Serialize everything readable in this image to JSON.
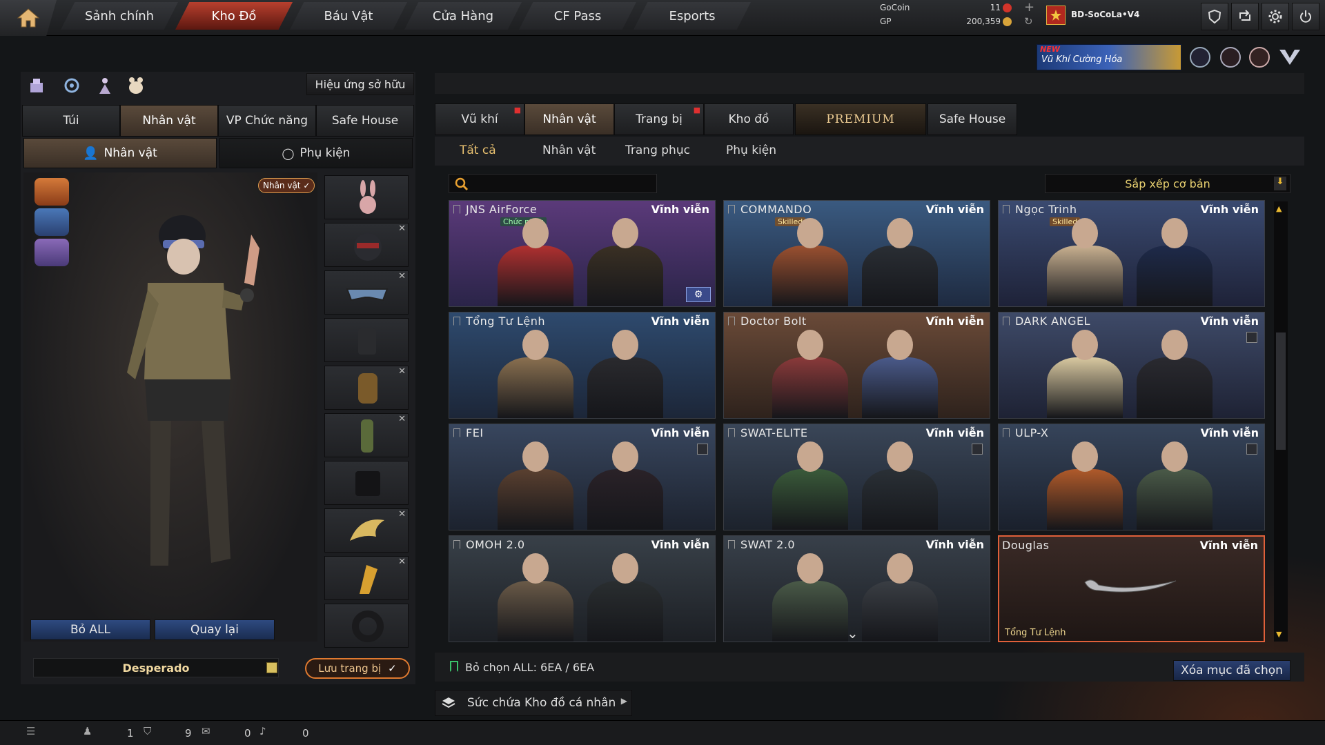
{
  "nav": {
    "tabs": [
      "Sảnh chính",
      "Kho Đồ",
      "Báu Vật",
      "Cửa Hàng",
      "CF Pass",
      "Esports"
    ],
    "active_index": 1
  },
  "currency": {
    "gocoin_label": "GoCoin",
    "gocoin_value": "11",
    "gp_label": "GP",
    "gp_value": "200,359"
  },
  "player": {
    "name": "BD-SoCoLa•V4"
  },
  "promo": {
    "new_label": "NEW",
    "text": "Vũ Khí Cường Hóa"
  },
  "left": {
    "effect_button": "Hiệu ứng sở hữu",
    "tabs": [
      "Túi",
      "Nhân vật",
      "VP Chức năng",
      "Safe House"
    ],
    "active_tab": 1,
    "subtabs": [
      "Nhân vật",
      "Phụ kiện"
    ],
    "character_badge": "Nhân vật ✓",
    "remove_all": "Bỏ ALL",
    "back": "Quay lại",
    "preset_name": "Desperado",
    "save_button": "Lưu trang bị"
  },
  "right": {
    "tabs": [
      "Vũ khí",
      "Nhân vật",
      "Trang bị",
      "Kho đồ",
      "PREMIUM",
      "Safe House"
    ],
    "active_tab": 1,
    "filters": [
      "Tất cả",
      "Nhân vật",
      "Trang phục",
      "Phụ kiện"
    ],
    "active_filter": 0,
    "search_placeholder": "",
    "sort_label": "Sắp xếp cơ bản",
    "items": [
      {
        "name": "JNS AirForce",
        "duration": "Vĩnh viễn",
        "tag": "Chức năng",
        "tag_type": "func",
        "gear": true
      },
      {
        "name": "COMMANDO",
        "duration": "Vĩnh viễn",
        "tag": "Skilled",
        "tag_type": "skilled"
      },
      {
        "name": "Ngọc Trinh",
        "duration": "Vĩnh viễn",
        "tag": "Skilled",
        "tag_type": "skilled"
      },
      {
        "name": "Tổng Tư Lệnh",
        "duration": "Vĩnh viễn"
      },
      {
        "name": "Doctor Bolt",
        "duration": "Vĩnh viễn"
      },
      {
        "name": "DARK ANGEL",
        "duration": "Vĩnh viễn",
        "lock": true
      },
      {
        "name": "FEI",
        "duration": "Vĩnh viễn",
        "lock": true
      },
      {
        "name": "SWAT-ELITE",
        "duration": "Vĩnh viễn",
        "lock": true
      },
      {
        "name": "ULP-X",
        "duration": "Vĩnh viễn",
        "lock": true
      },
      {
        "name": "OMOH 2.0",
        "duration": "Vĩnh viễn"
      },
      {
        "name": "SWAT 2.0",
        "duration": "Vĩnh viễn"
      },
      {
        "name": "Douglas",
        "duration": "Vĩnh viễn",
        "sub": "Tổng Tư Lệnh",
        "selected": true
      }
    ],
    "deselect_all": "Bỏ chọn ALL: 6EA / 6EA",
    "delete_selected": "Xóa mục đã chọn",
    "capacity": "Sức chứa Kho đồ cá nhân"
  },
  "status": {
    "v1": "1",
    "v2": "9",
    "v3": "0",
    "v4": "0"
  }
}
